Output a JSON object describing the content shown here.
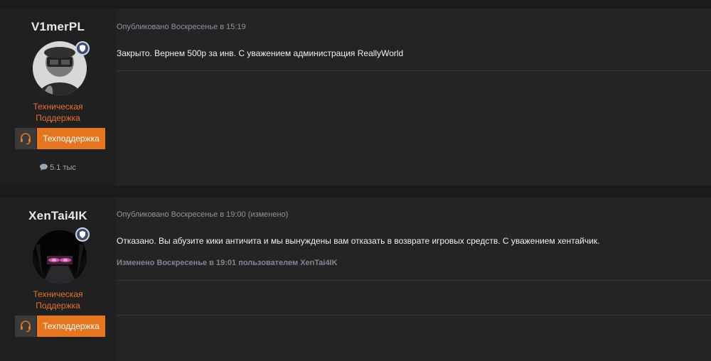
{
  "posts": [
    {
      "username": "V1merPL",
      "role_line1": "Техническая",
      "role_line2": "Поддержка",
      "role_button": "Техподдержка",
      "message_count": "5.1 тыс",
      "meta": "Опубликовано Воскресенье в 15:19",
      "text": "Закрыто. Вернем 500р за инв. С уважением администрация ReallyWorld"
    },
    {
      "username": "XenTai4IK",
      "role_line1": "Техническая",
      "role_line2": "Поддержка",
      "role_button": "Техподдержка",
      "meta": "Опубликовано Воскресенье в 19:00 (изменено)",
      "text": "Отказано. Вы абузите кики античита и мы вынуждены вам отказать в возврате игровых средств. С уважением хентайчик.",
      "edited_note": "Изменено Воскресенье в 19:01 пользователем XenTai4IK"
    }
  ],
  "colors": {
    "accent": "#e5761f",
    "role_text": "#e8702a",
    "meta_text": "#8a94a3",
    "background": "#1a1a1a",
    "post_background": "#242424"
  },
  "icons": {
    "badge": "shield-icon",
    "role": "headset-icon",
    "messages": "speech-bubble-icon"
  }
}
